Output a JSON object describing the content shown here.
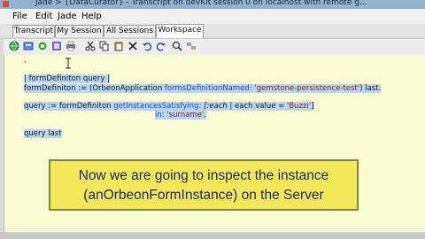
{
  "window": {
    "title": "Jade > {DataCurator} - Transcript on devKit session 0 on localhost with remote g..."
  },
  "menu": [
    "File",
    "Edit",
    "Jade",
    "Help"
  ],
  "tabs": [
    "Transcript",
    "My Session",
    "All Sessions",
    "Workspace"
  ],
  "active_tab": "Workspace",
  "toolbar": {
    "icons": [
      "globe-icon",
      "inspect-icon",
      "debug-icon",
      "browse-icon",
      "print-icon",
      "cut-icon",
      "copy-icon",
      "paste-icon",
      "delete-icon",
      "undo-icon",
      "redo-icon",
      "find-icon",
      "replace-icon"
    ]
  },
  "editor": {
    "lines": {
      "l1": "'",
      "l2": "| formDefiniton query |",
      "l3a": "formDefiniton  := (OrbeonApplication ",
      "l3b": "formsDefinitionNamed:",
      "l3c": " 'gemstone-persistence-test'",
      "l3d": ") last.",
      "l4a": "query := formDefiniton ",
      "l4b": "getInstancesSatisfying:",
      "l4c": " [:each",
      "l4d": " | each value = ",
      "l4e": "'Buzzi'",
      "l4f": "]",
      "l5a": "in:",
      "l5b": " 'surname'",
      "l5c": ".",
      "l6": "query last"
    }
  },
  "callout": {
    "line1": "Now we are going to inspect the instance",
    "line2": "(anOrbeonFormInstance) on the Server"
  },
  "colors": {
    "callout_bg": "#f4e85a",
    "editor_bg": "#fbfbd3",
    "selection": "#b8d5f2"
  }
}
